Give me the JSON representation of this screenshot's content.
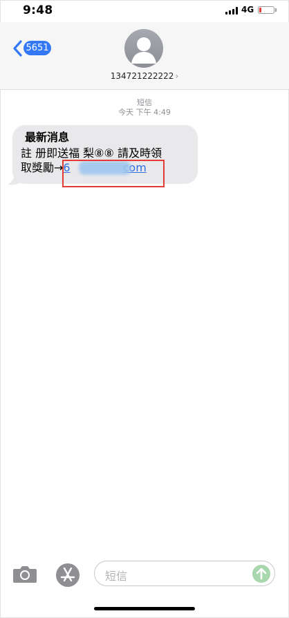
{
  "status_bar": {
    "time": "9:48",
    "network": "4G",
    "battery_level": 0.1
  },
  "header": {
    "back_label": "5651",
    "contact": "134721222222",
    "contact_chevron": "›"
  },
  "thread": {
    "service": "短信",
    "timestamp": "今天 下午 4:49",
    "message": {
      "title": "最新消息",
      "line1": "註 册即送福 梨⑧⑧ 請及時領",
      "line2_prefix": "取獎勵→",
      "link_start": "6",
      "link_end": "com"
    }
  },
  "input_bar": {
    "placeholder": "短信"
  },
  "colors": {
    "accent": "#3478f6",
    "bubble": "#e9e9eb",
    "highlight": "#e33a34",
    "send": "#a8d6ad"
  },
  "icons": [
    "back-chevron-icon",
    "avatar-icon",
    "camera-icon",
    "app-store-icon",
    "send-arrow-icon"
  ]
}
